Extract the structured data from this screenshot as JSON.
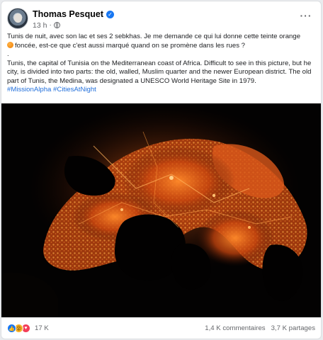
{
  "post": {
    "author": "Thomas Pesquet",
    "time": "13 h",
    "separator": "·",
    "text_fr_1": "Tunis de nuit, avec son lac et ses 2 sebkhas. Je me demande ce qui lui donne cette teinte orange",
    "text_fr_2": "foncée, est-ce que c'est aussi marqué quand on se promène dans les rues ?",
    "text_dot": ".",
    "text_en": "Tunis, the capital of Tunisia on the Mediterranean coast of Africa. Difficult to see in this picture, but he city, is divided into two parts: the old, walled, Muslim quarter and the newer European district. The old part of Tunis, the Medina, was designated a UNESCO World Heritage Site in 1979.",
    "hashtags": "#MissionAlpha #CitiesAtNight"
  },
  "footer": {
    "reaction_count": "17 K",
    "comments": "1,4 K commentaires",
    "shares": "3,7 K partages"
  },
  "icons": {
    "verified": "verified-badge-icon",
    "audience": "globe-icon",
    "more": "more-options-icon",
    "reactions": [
      "like-icon",
      "wow-icon",
      "love-icon"
    ]
  },
  "colors": {
    "accent": "#1877f2",
    "city_lights": "#e8641a",
    "photo_background": "#000000"
  }
}
